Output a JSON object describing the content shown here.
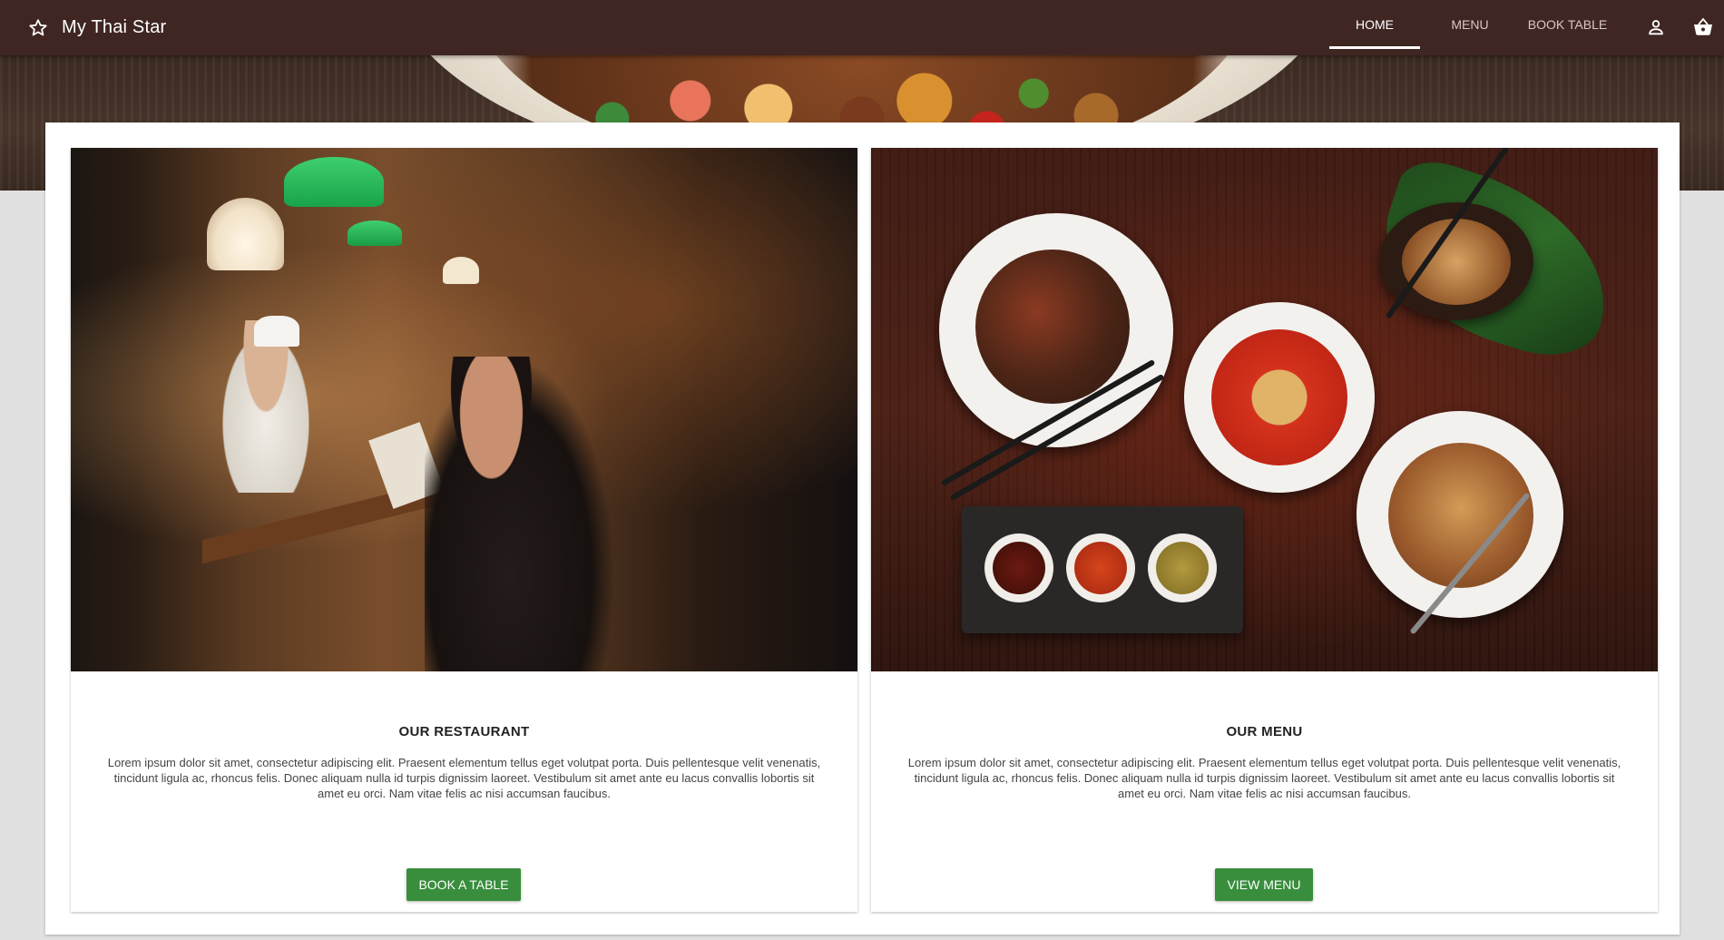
{
  "app": {
    "title": "My Thai Star"
  },
  "nav": {
    "tabs": [
      {
        "label": "HOME",
        "active": true
      },
      {
        "label": "MENU",
        "active": false
      },
      {
        "label": "BOOK TABLE",
        "active": false
      }
    ],
    "icons": [
      "account-icon",
      "shopping-basket-icon"
    ]
  },
  "cards": [
    {
      "title": "OUR RESTAURANT",
      "text": "Lorem ipsum dolor sit amet, consectetur adipiscing elit. Praesent elementum tellus eget volutpat porta. Duis pellentesque velit venenatis, tincidunt ligula ac, rhoncus felis. Donec aliquam nulla id turpis dignissim laoreet. Vestibulum sit amet ante eu lacus convallis lobortis sit amet eu orci. Nam vitae felis ac nisi accumsan faucibus.",
      "button": "BOOK A TABLE"
    },
    {
      "title": "OUR MENU",
      "text": "Lorem ipsum dolor sit amet, consectetur adipiscing elit. Praesent elementum tellus eget volutpat porta. Duis pellentesque velit venenatis, tincidunt ligula ac, rhoncus felis. Donec aliquam nulla id turpis dignissim laoreet. Vestibulum sit amet ante eu lacus convallis lobortis sit amet eu orci. Nam vitae felis ac nisi accumsan faucibus.",
      "button": "VIEW MENU"
    }
  ],
  "colors": {
    "toolbar": "#3f2622",
    "accent_button": "#388e3c",
    "page_background": "#e1e1e1"
  }
}
